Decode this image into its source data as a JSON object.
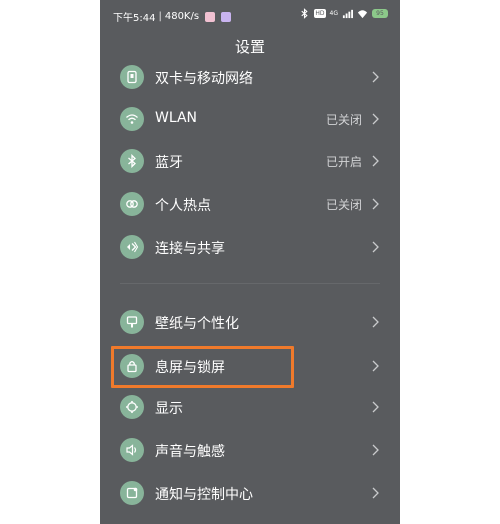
{
  "statusbar": {
    "time": "下午5:44",
    "separator": "|",
    "speed": "480K/s",
    "hd": "HD",
    "signal": "4G",
    "battery": "95"
  },
  "page_title": "设置",
  "items": [
    {
      "label": "双卡与移动网络",
      "status": "",
      "icon": "sim-card-icon"
    },
    {
      "label": "WLAN",
      "status": "已关闭",
      "icon": "wifi-icon"
    },
    {
      "label": "蓝牙",
      "status": "已开启",
      "icon": "bluetooth-icon"
    },
    {
      "label": "个人热点",
      "status": "已关闭",
      "icon": "hotspot-icon"
    },
    {
      "label": "连接与共享",
      "status": "",
      "icon": "share-icon"
    },
    {
      "label": "壁纸与个性化",
      "status": "",
      "icon": "wallpaper-icon"
    },
    {
      "label": "息屏与锁屏",
      "status": "",
      "icon": "lock-icon"
    },
    {
      "label": "显示",
      "status": "",
      "icon": "display-icon"
    },
    {
      "label": "声音与触感",
      "status": "",
      "icon": "sound-icon"
    },
    {
      "label": "通知与控制中心",
      "status": "",
      "icon": "notification-icon"
    }
  ],
  "colors": {
    "background": "#595b5e",
    "icon_circle": "#88b49a",
    "highlight": "#f07a2b"
  }
}
